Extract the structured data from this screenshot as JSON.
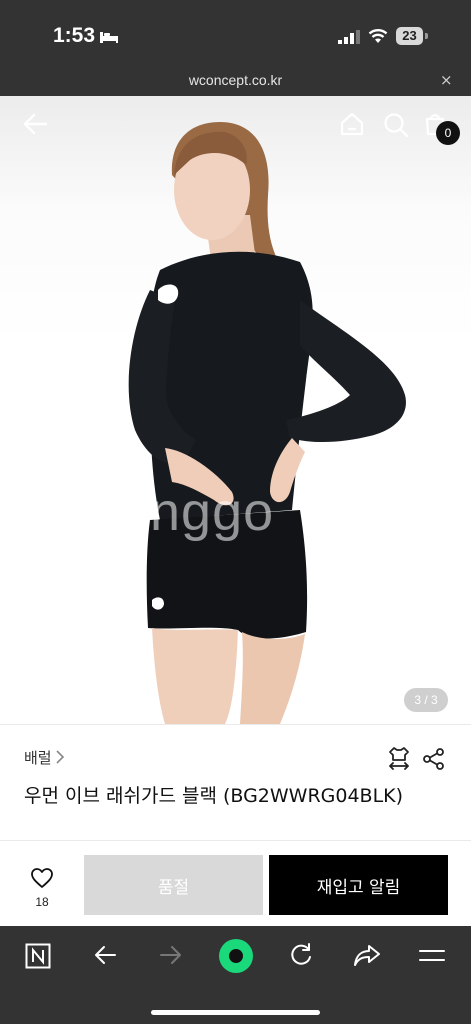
{
  "status": {
    "time": "1:53",
    "battery": "23"
  },
  "browser": {
    "url": "wconcept.co.kr",
    "close_label": "×"
  },
  "hero": {
    "cart_count": "0",
    "watermark": "nggo",
    "image_counter": "3 / 3"
  },
  "product": {
    "brand": "배럴",
    "title": "우먼 이브 래쉬가드 블랙 (BG2WWRG04BLK)"
  },
  "actions": {
    "like_count": "18",
    "soldout_label": "품절",
    "restock_label": "재입고 알림"
  },
  "colors": {
    "browser_bar": "#333333",
    "accent_green": "#19d97b",
    "button_black": "#000000",
    "button_disabled": "#d9d9d9"
  }
}
